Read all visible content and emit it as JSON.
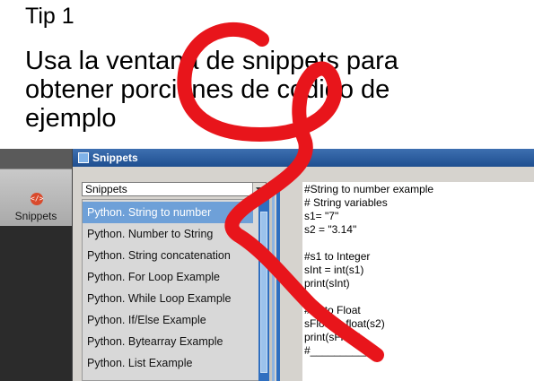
{
  "slide": {
    "tip": "Tip 1",
    "heading_lines": [
      "Usa la ventana de snippets para",
      "obtener porciones de codigo de",
      "ejemplo"
    ]
  },
  "sidebar": {
    "snippets_button_label": "Snippets",
    "snippets_icon": "code-icon"
  },
  "window": {
    "title": "Snippets",
    "dropdown_value": "Snippets",
    "items": [
      "Python. String to number",
      "Python. Number to String",
      "Python. String concatenation",
      "Python. For Loop Example",
      "Python. While Loop Example",
      "Python. If/Else Example",
      "Python. Bytearray Example",
      "Python. List Example"
    ],
    "selected_index": 0,
    "code_lines": [
      "#String to number example",
      "# String variables",
      "s1= \"7\"",
      "s2 = \"3.14\"",
      "",
      "#s1 to Integer",
      "sInt = int(s1)",
      "print(sInt)",
      "",
      "#s2 to Float",
      "sFloat = float(s2)",
      "print(sFloat)",
      "#___________"
    ]
  },
  "colors": {
    "annotation": "#e8151b",
    "titlebar": "#1f4f90",
    "selection": "#6ea0d8"
  }
}
